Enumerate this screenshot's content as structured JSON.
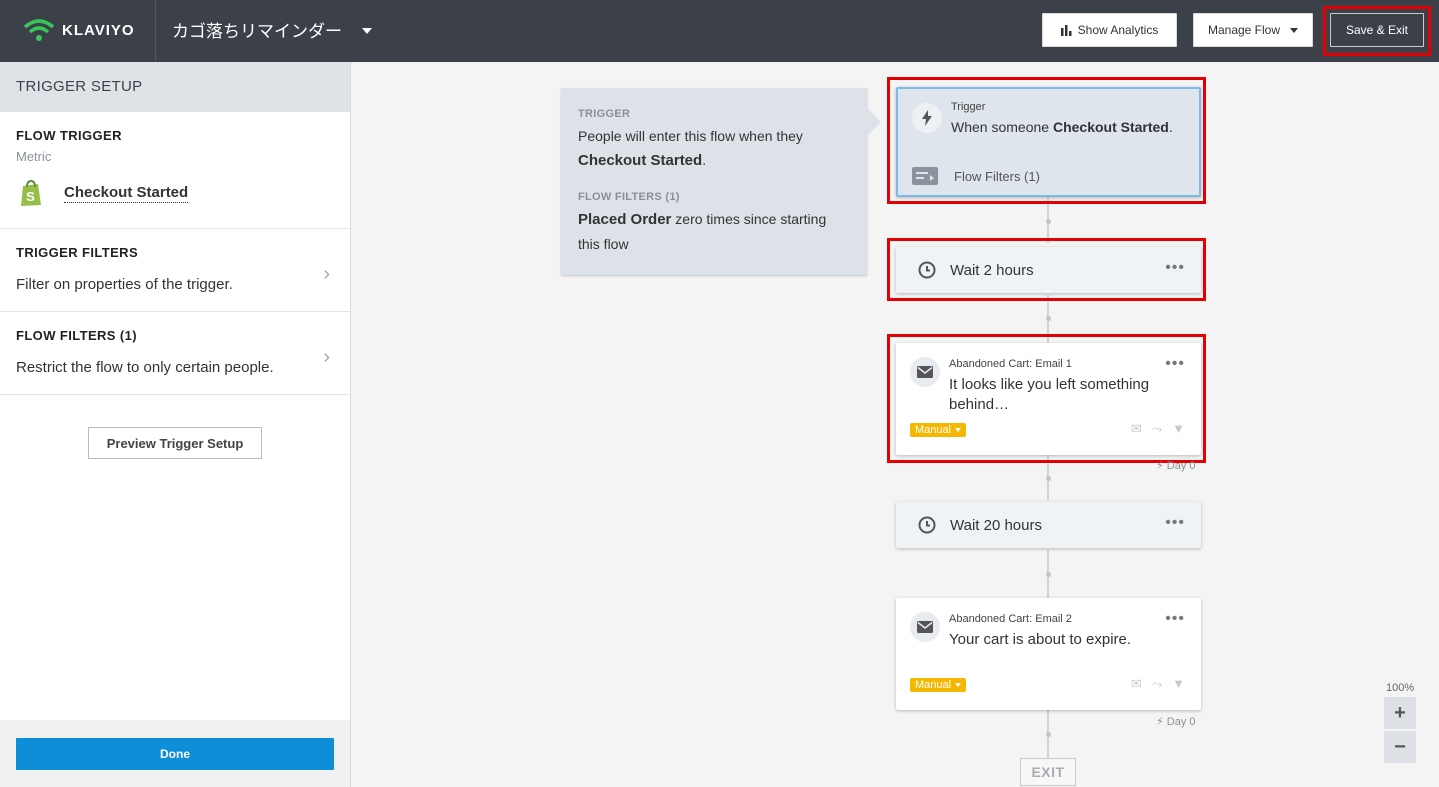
{
  "header": {
    "logo_text": "KLAVIYO",
    "flow_name": "カゴ落ちリマインダー",
    "show_analytics": "Show Analytics",
    "manage_flow": "Manage Flow",
    "save_exit": "Save & Exit"
  },
  "sidebar": {
    "title": "TRIGGER SETUP",
    "flow_trigger": {
      "title": "FLOW TRIGGER",
      "subtitle": "Metric",
      "metric": "Checkout Started"
    },
    "trigger_filters": {
      "title": "TRIGGER FILTERS",
      "desc": "Filter on properties of the trigger."
    },
    "flow_filters": {
      "title": "FLOW FILTERS (1)",
      "desc": "Restrict the flow to only certain people."
    },
    "preview_button": "Preview Trigger Setup",
    "done_button": "Done"
  },
  "tooltip": {
    "trigger_label": "TRIGGER",
    "trigger_text_pre": "People will enter this flow when they",
    "trigger_metric": "Checkout Started",
    "trigger_text_post": ".",
    "filters_label": "FLOW FILTERS (1)",
    "filter_bold": "Placed Order",
    "filter_text": " zero times since starting this flow"
  },
  "nodes": {
    "trigger": {
      "label": "Trigger",
      "text_pre": "When someone ",
      "metric": "Checkout Started",
      "text_post": ".",
      "filters": "Flow Filters (1)"
    },
    "wait1": {
      "text": "Wait 2 hours"
    },
    "email1": {
      "label": "Abandoned Cart: Email 1",
      "text": "It looks like you left something behind…",
      "badge": "Manual",
      "day": "Day 0"
    },
    "wait2": {
      "text": "Wait 20 hours"
    },
    "email2": {
      "label": "Abandoned Cart: Email 2",
      "text": "Your cart is about to expire.",
      "badge": "Manual",
      "day": "Day 0"
    },
    "exit": "EXIT"
  },
  "zoom": {
    "level": "100%",
    "plus": "+",
    "minus": "−"
  },
  "colors": {
    "header_bg": "#3c4048",
    "accent_blue": "#0f8ed8",
    "badge_yellow": "#f5b800",
    "highlight_red": "#e40000",
    "shopify_green": "#95bf47",
    "logo_green": "#22c55e"
  },
  "dots_label": "•••"
}
